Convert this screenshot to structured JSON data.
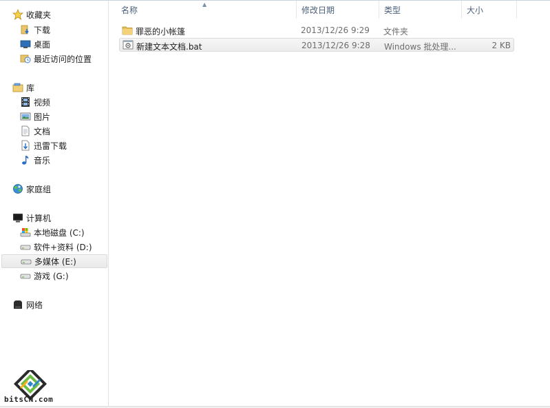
{
  "nav": {
    "favorites": {
      "label": "收藏夹",
      "icon": "star-icon"
    },
    "favorites_items": [
      {
        "label": "下载",
        "icon": "download-folder-icon"
      },
      {
        "label": "桌面",
        "icon": "desktop-icon"
      },
      {
        "label": "最近访问的位置",
        "icon": "recent-places-icon"
      }
    ],
    "libraries": {
      "label": "库",
      "icon": "library-icon"
    },
    "libraries_items": [
      {
        "label": "视频",
        "icon": "video-icon"
      },
      {
        "label": "图片",
        "icon": "picture-icon"
      },
      {
        "label": "文档",
        "icon": "document-icon"
      },
      {
        "label": "迅雷下载",
        "icon": "download-folder-icon"
      },
      {
        "label": "音乐",
        "icon": "music-icon"
      }
    ],
    "homegroup": {
      "label": "家庭组",
      "icon": "homegroup-icon"
    },
    "computer": {
      "label": "计算机",
      "icon": "computer-icon"
    },
    "computer_items": [
      {
        "label": "本地磁盘 (C:)",
        "icon": "system-drive-icon"
      },
      {
        "label": "软件+资料 (D:)",
        "icon": "drive-icon"
      },
      {
        "label": "多媒体 (E:)",
        "icon": "drive-icon",
        "selected": true
      },
      {
        "label": "游戏 (G:)",
        "icon": "drive-icon"
      }
    ],
    "network": {
      "label": "网络",
      "icon": "network-icon"
    }
  },
  "columns": {
    "name": "名称",
    "date": "修改日期",
    "type": "类型",
    "size": "大小",
    "sort_indicator": "▲"
  },
  "files": [
    {
      "name": "罪恶的小帐篷",
      "date": "2013/12/26 9:29",
      "type": "文件夹",
      "size": "",
      "icon": "folder-icon"
    },
    {
      "name": "新建文本文档.bat",
      "date": "2013/12/26 9:28",
      "type": "Windows 批处理...",
      "size": "2 KB",
      "icon": "batch-file-icon",
      "selected": true
    }
  ],
  "watermark": {
    "text": "bitsCN.com"
  }
}
